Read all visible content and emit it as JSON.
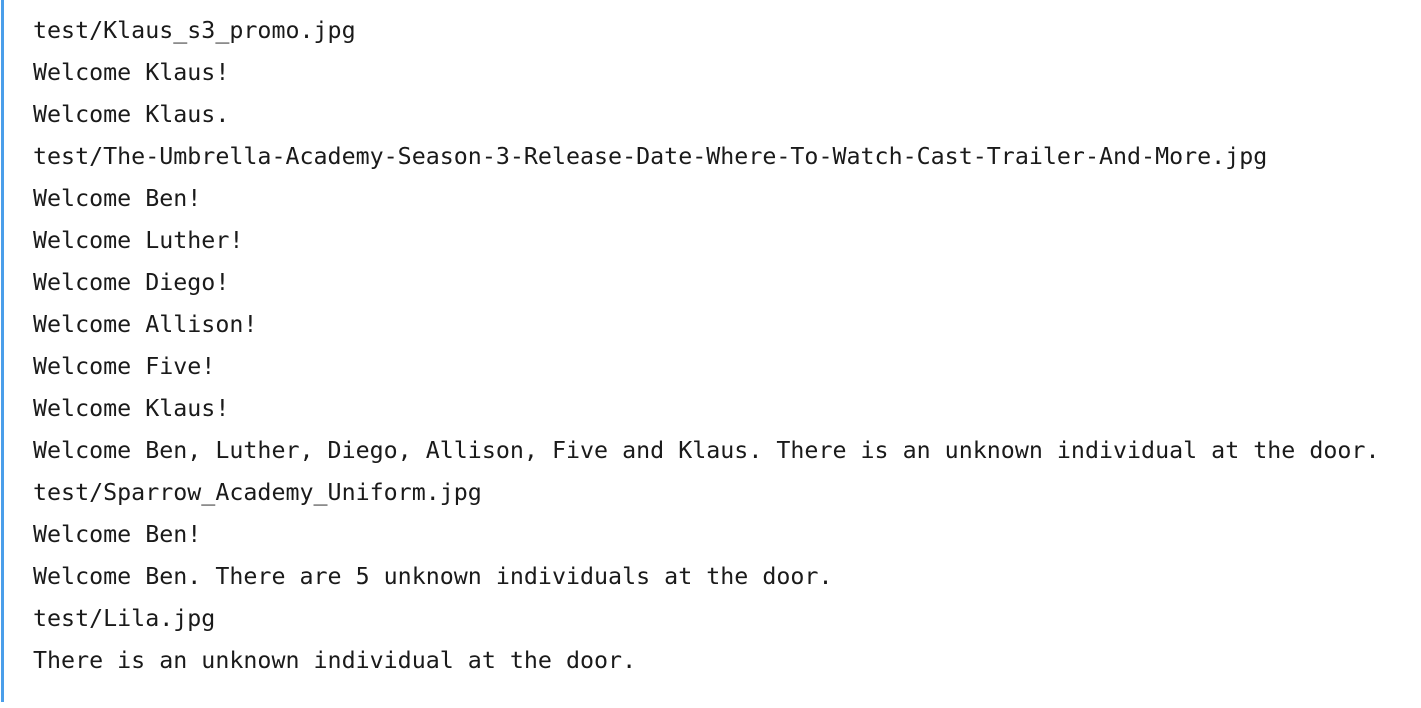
{
  "cell": {
    "gutter_color": "#4a9eea",
    "background_color": "#ffffff",
    "text_color": "#1a1a1a"
  },
  "output": {
    "stream_name": "stdout",
    "lines": [
      "test/Klaus_s3_promo.jpg",
      "Welcome Klaus!",
      "Welcome Klaus.",
      "test/The-Umbrella-Academy-Season-3-Release-Date-Where-To-Watch-Cast-Trailer-And-More.jpg",
      "Welcome Ben!",
      "Welcome Luther!",
      "Welcome Diego!",
      "Welcome Allison!",
      "Welcome Five!",
      "Welcome Klaus!",
      "Welcome Ben, Luther, Diego, Allison, Five and Klaus. There is an unknown individual at the door.",
      "test/Sparrow_Academy_Uniform.jpg",
      "Welcome Ben!",
      "Welcome Ben. There are 5 unknown individuals at the door.",
      "test/Lila.jpg",
      "There is an unknown individual at the door."
    ]
  }
}
